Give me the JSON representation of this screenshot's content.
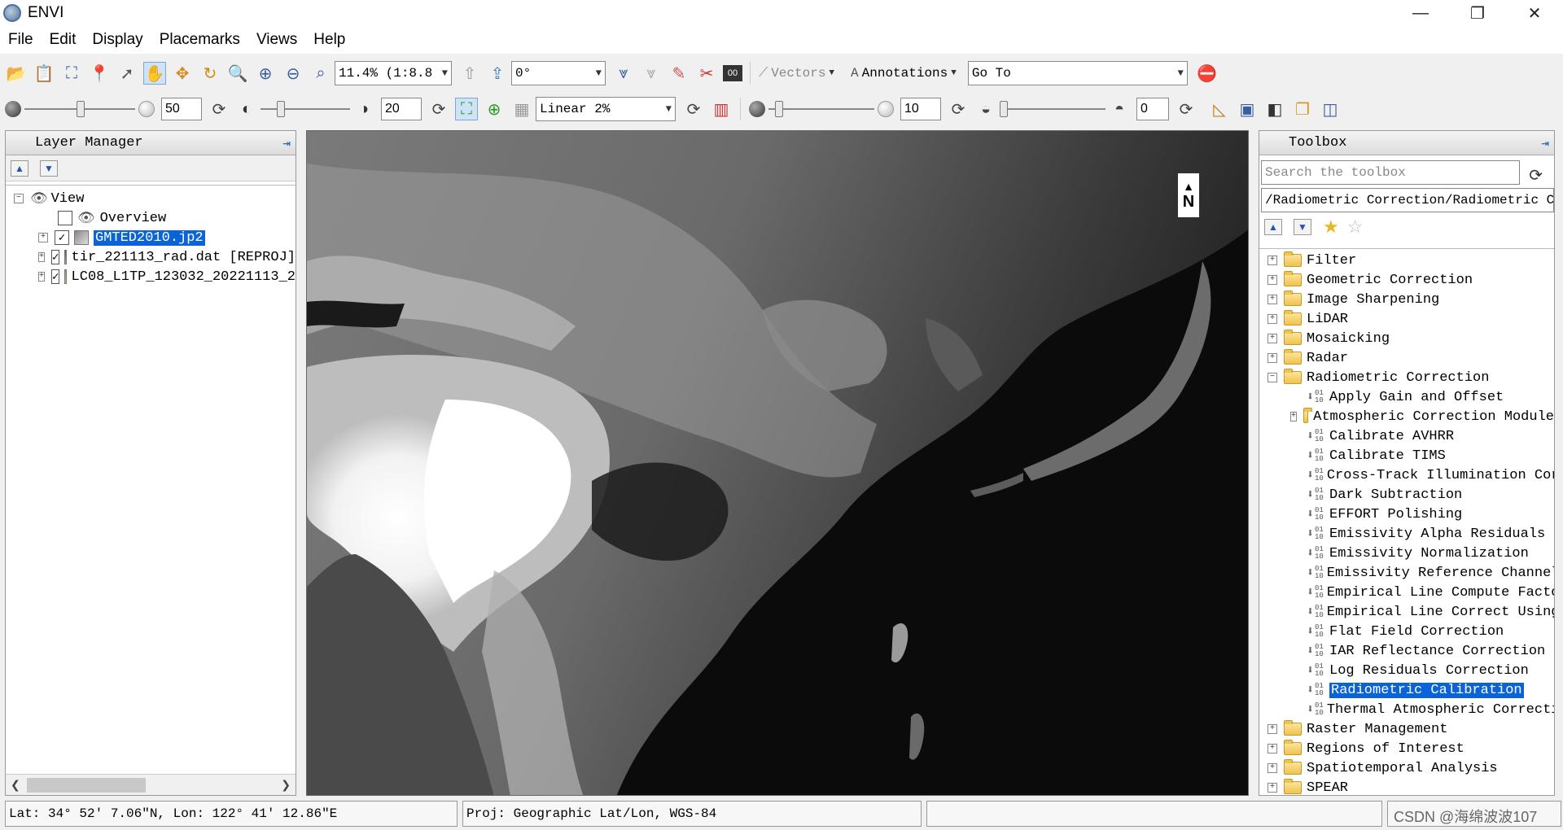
{
  "window": {
    "title": "ENVI",
    "controls": [
      "—",
      "❐",
      "✕"
    ]
  },
  "menu": [
    "File",
    "Edit",
    "Display",
    "Placemarks",
    "Views",
    "Help"
  ],
  "toolbar1": {
    "zoom_value": "11.4% (1:8.8",
    "rotation_value": "0°",
    "vectors_label": "Vectors",
    "annotations_label": "Annotations",
    "goto_value": "Go To"
  },
  "toolbar2": {
    "brightness_value": "50",
    "contrast_value": "20",
    "stretch_value": "Linear 2%",
    "sharpen_value": "10",
    "transparency_value": "0"
  },
  "layer_manager": {
    "title": "Layer Manager",
    "view_label": "View",
    "overview_label": "Overview",
    "layers": [
      {
        "label": "GMTED2010.jp2",
        "checked": true,
        "selected": true
      },
      {
        "label": "tir_221113_rad.dat [REPROJ]",
        "checked": true,
        "selected": false
      },
      {
        "label": "LC08_L1TP_123032_20221113_2",
        "checked": true,
        "selected": false
      }
    ]
  },
  "map": {
    "north_label": "N"
  },
  "toolbox": {
    "title": "Toolbox",
    "search_placeholder": "Search the toolbox",
    "path": "/Radiometric Correction/Radiometric Calibration",
    "folders_before": [
      "Filter",
      "Geometric Correction",
      "Image Sharpening",
      "LiDAR",
      "Mosaicking",
      "Radar"
    ],
    "open_folder": "Radiometric Correction",
    "items": [
      {
        "label": "Apply Gain and Offset",
        "type": "tool"
      },
      {
        "label": "Atmospheric Correction Module",
        "type": "folder"
      },
      {
        "label": "Calibrate AVHRR",
        "type": "tool"
      },
      {
        "label": "Calibrate TIMS",
        "type": "tool"
      },
      {
        "label": "Cross-Track Illumination Corre",
        "type": "tool"
      },
      {
        "label": "Dark Subtraction",
        "type": "tool"
      },
      {
        "label": "EFFORT Polishing",
        "type": "tool"
      },
      {
        "label": "Emissivity Alpha Residuals",
        "type": "tool"
      },
      {
        "label": "Emissivity Normalization",
        "type": "tool"
      },
      {
        "label": "Emissivity Reference Channel",
        "type": "tool"
      },
      {
        "label": "Empirical Line Compute Factors",
        "type": "tool"
      },
      {
        "label": "Empirical Line Correct Using E",
        "type": "tool"
      },
      {
        "label": "Flat Field Correction",
        "type": "tool"
      },
      {
        "label": "IAR Reflectance Correction",
        "type": "tool"
      },
      {
        "label": "Log Residuals Correction",
        "type": "tool"
      },
      {
        "label": "Radiometric Calibration",
        "type": "tool",
        "selected": true
      },
      {
        "label": "Thermal Atmospheric Correction",
        "type": "tool"
      }
    ],
    "folders_after": [
      "Raster Management",
      "Regions of Interest",
      "Spatiotemporal Analysis",
      "SPEAR"
    ]
  },
  "status": {
    "latlon": "Lat: 34° 52′ 7.06″N, Lon: 122° 41′ 12.86″E",
    "proj": "Proj: Geographic Lat/Lon, WGS-84",
    "watermark": "CSDN @海绵波波107"
  },
  "colors": {
    "selection": "#0a64d8",
    "background": "#f0f0f0"
  }
}
